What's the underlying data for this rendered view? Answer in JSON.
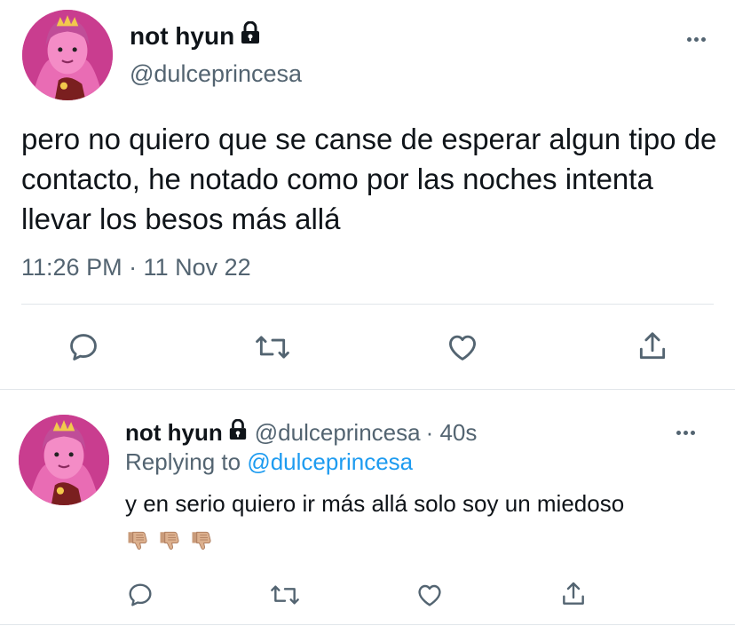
{
  "main_tweet": {
    "display_name": "not hyun",
    "handle": "@dulceprincesa",
    "text": "pero no quiero que se canse de esperar algun tipo de contacto, he notado como por las noches intenta llevar los besos más allá",
    "timestamp": "11:26 PM · 11 Nov 22",
    "actions": [
      "reply-icon",
      "retweet-icon",
      "like-icon",
      "share-icon"
    ]
  },
  "reply_tweet": {
    "display_name": "not hyun",
    "handle": "@dulceprincesa",
    "time_ago": "· 40s",
    "replying_to_label": "Replying to",
    "replying_to_handle": "@dulceprincesa",
    "text": "y en serio quiero ir más allá solo soy un miedoso",
    "emoji": [
      "thumbs-down-emoji",
      "thumbs-down-emoji",
      "thumbs-down-emoji"
    ],
    "actions": [
      "reply-icon",
      "retweet-icon",
      "like-icon",
      "share-icon"
    ]
  },
  "colors": {
    "text": "#0f1419",
    "secondary": "#536471",
    "link": "#1d9bf0",
    "divider": "#e1e6ea",
    "avatar_pink": "#d44a9b"
  }
}
